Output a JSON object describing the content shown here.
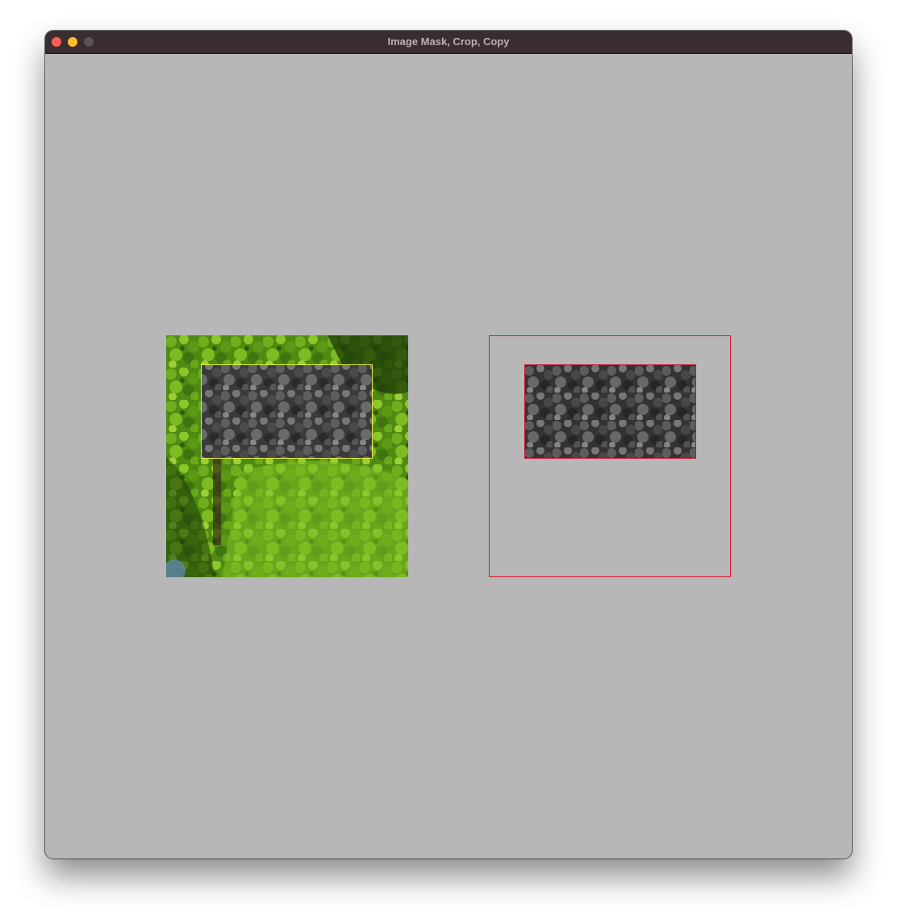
{
  "window": {
    "title": "Image Mask, Crop, Copy",
    "background_color": "#b7b7b7",
    "titlebar_color": "#3a2d30"
  },
  "traffic_lights": [
    {
      "name": "close",
      "color": "#fe5f57"
    },
    {
      "name": "minimize",
      "color": "#febc2e"
    },
    {
      "name": "zoom",
      "color": "#5a5255"
    }
  ],
  "source_image": {
    "content": "foliage photo with grayscale masked region",
    "selection_color": "#e8e84a"
  },
  "copy_frame": {
    "frame_color": "#e0102a",
    "content": "grayscale cropped copy of selection"
  }
}
